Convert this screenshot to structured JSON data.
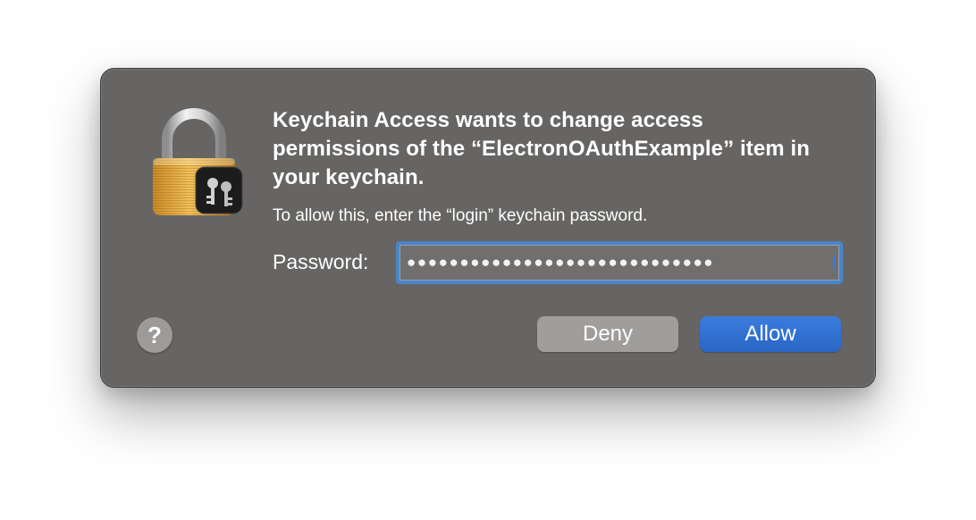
{
  "dialog": {
    "app_icon": "keychain-lock-icon",
    "title": "Keychain Access wants to change access permissions of the “ElectronOAuthExample” item in your keychain.",
    "message": "To allow this, enter the “login” keychain password.",
    "password": {
      "label": "Password:",
      "masked_value": "●●●●●●●●●●●●●●●●●●●●●●●●●●●●●",
      "focused": true
    },
    "help_button": {
      "label": "?",
      "icon": "question-mark-icon"
    },
    "buttons": {
      "deny_label": "Deny",
      "allow_label": "Allow"
    },
    "colors": {
      "dialog_background": "#676563",
      "accent": "#2f6fd0",
      "focus_ring": "#4a84c9",
      "secondary_button": "#a09e9c"
    }
  }
}
